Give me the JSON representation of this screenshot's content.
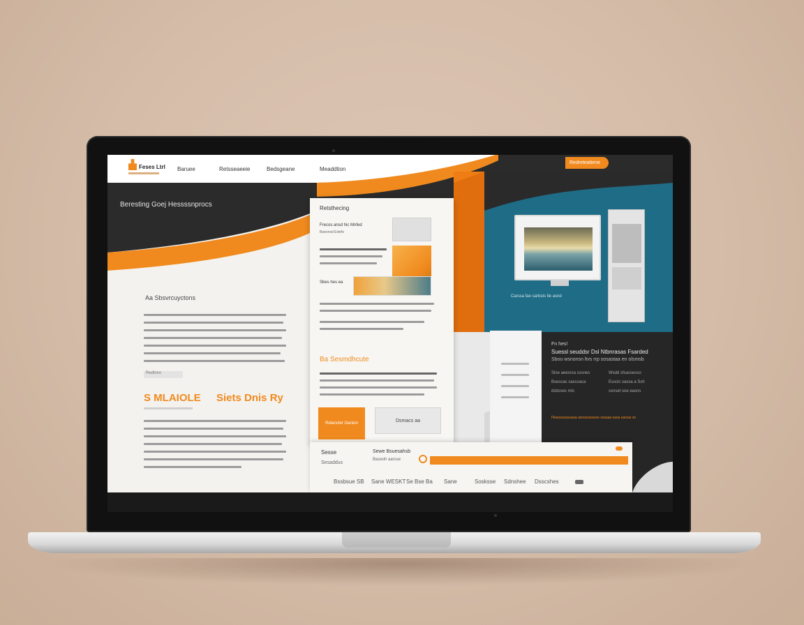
{
  "site": {
    "logo_text": "Feses Ltrl",
    "nav": [
      "Baruee",
      "Retsseaeeie",
      "Bedsgeane",
      "Meaddtion"
    ],
    "cta_label": "Redreteatiene"
  },
  "hero": {
    "tagline": "Beresting Goej Hessssnprocs"
  },
  "left_column": {
    "heading": "Aa Sbsvrcuyctons",
    "button_label": "Redlnxo",
    "orange_left": "S MLAIOLE",
    "orange_right": "Siets Dnis Ry"
  },
  "paper": {
    "title": "Retsthecing",
    "card_label": "Frecos ansd hic Mnfed",
    "card_sub": "Baeonsd Estirfs",
    "caption_label": "Sbes hes ea",
    "section_heading": "Ba Sesmdhcute",
    "btn_orange_label": "Relancter Ganion",
    "btn_grey_label": "Dsmacs aa"
  },
  "right_panel": {
    "caption": "Carssa fao sarbsts tle asnd",
    "eyebrow": "Fn hes!",
    "title": "Suessl seuddsr Dsl Ntbnrasas Fsarded",
    "subtitle": "Sbou wsnonsn ltvs rrp sosastaa en olsmsb",
    "col1": [
      "Stse aeesrsa sssnes",
      "Bsescac sasssaca",
      "dsbsses mls"
    ],
    "col2": [
      "Wsdd sfsassesso",
      "Essclc sassa a Ssh",
      "ssnset soe easns"
    ],
    "footer": "Fllasssssasusaa asnssssssses sssaaa saoa sarsas sn"
  },
  "bottom_bar": {
    "left_title": "Sesse",
    "left_sub": "Sesaddus",
    "mid_title": "Sewe Bsuesahsb",
    "mid_sub": "Baseoh aarsse",
    "progress_value": 1.0,
    "links": [
      "Bssbsue SB",
      "Sane WESKT",
      "Se Bse Ba",
      "Sane",
      "Sosksse",
      "Sdnshee",
      "Dsscshes"
    ]
  },
  "colors": {
    "accent": "#f08a1e",
    "dark": "#2b2b2b",
    "teal": "#1f6c86",
    "paper": "#f7f6f3"
  }
}
